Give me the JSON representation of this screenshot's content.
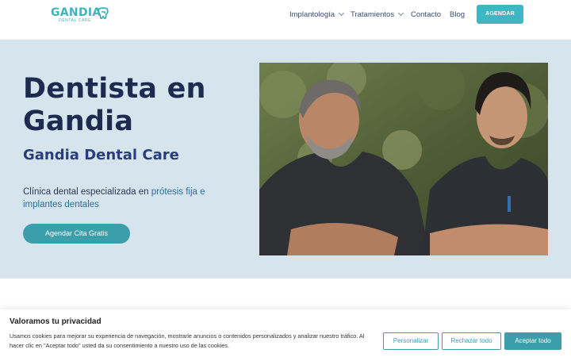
{
  "header": {
    "logo": {
      "word": "GANDIA",
      "sub": "DENTAL CARE"
    },
    "nav": [
      {
        "label": "Implantología",
        "has_dropdown": true
      },
      {
        "label": "Tratamientos",
        "has_dropdown": true
      },
      {
        "label": "Contacto",
        "has_dropdown": false
      },
      {
        "label": "Blog",
        "has_dropdown": false
      }
    ],
    "cta_label": "AGENDAR"
  },
  "hero": {
    "title": "Dentista en Gandia",
    "subtitle": "Gandia Dental Care",
    "desc_part1": "Clínica dental especializada en ",
    "desc_accent": "prótesis fija e implantes dentales",
    "cta_label": "Agendar Cita Gratis"
  },
  "cookie": {
    "title": "Valoramos tu privacidad",
    "text": "Usamos cookies para mejorar su experiencia de navegación, mostrarle anuncios o contenidos personalizados y analizar nuestro tráfico. Al hacer clic en \"Aceptar todo\" usted da su consentimiento a nuestro uso de las cookies.",
    "btn_customize": "Personalizar",
    "btn_reject": "Rechazar todo",
    "btn_accept": "Aceptar todo"
  },
  "colors": {
    "brand": "#3fb3bd",
    "hero_bg": "#d6e4ee",
    "title": "#1e2a4f",
    "button": "#3b9eab"
  }
}
